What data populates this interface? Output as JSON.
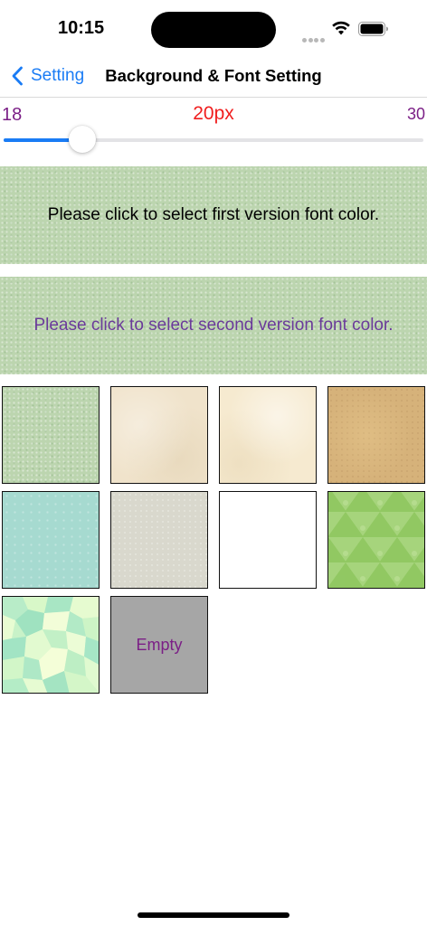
{
  "status_bar": {
    "time": "10:15",
    "icons": [
      "signal-dots-icon",
      "wifi-icon",
      "battery-icon"
    ]
  },
  "nav": {
    "back_label": "Setting",
    "title": "Background & Font Setting",
    "accent_color": "#1a7cf5"
  },
  "font_size_slider": {
    "min_label": "18",
    "max_label": "30",
    "current_label": "20px",
    "min": 18,
    "max": 30,
    "value": 20,
    "min_max_color": "#7b1f86",
    "current_color": "#f01e1e",
    "fill_color": "#1a7cf5"
  },
  "font_color_panels": {
    "first": {
      "text": "Please click to select first version font color.",
      "text_color": "#000000"
    },
    "second": {
      "text": "Please click to select second version font color.",
      "text_color": "#6a3a9a"
    }
  },
  "backgrounds": {
    "tiles": [
      {
        "name": "green-noise",
        "color": "#bcd5af"
      },
      {
        "name": "cream",
        "color": "#f0e3cb"
      },
      {
        "name": "parchment",
        "color": "#f6ead0"
      },
      {
        "name": "kraft",
        "color": "#d6b27a"
      },
      {
        "name": "aqua",
        "color": "#a6dad0"
      },
      {
        "name": "grey-paper",
        "color": "#d9d8cd"
      },
      {
        "name": "white",
        "color": "#ffffff"
      },
      {
        "name": "green-pattern",
        "color": "#a6d47c"
      },
      {
        "name": "mosaic",
        "color": "#c8f2c8"
      },
      {
        "name": "empty",
        "color": "#a6a6a6"
      }
    ],
    "empty_label": "Empty"
  }
}
